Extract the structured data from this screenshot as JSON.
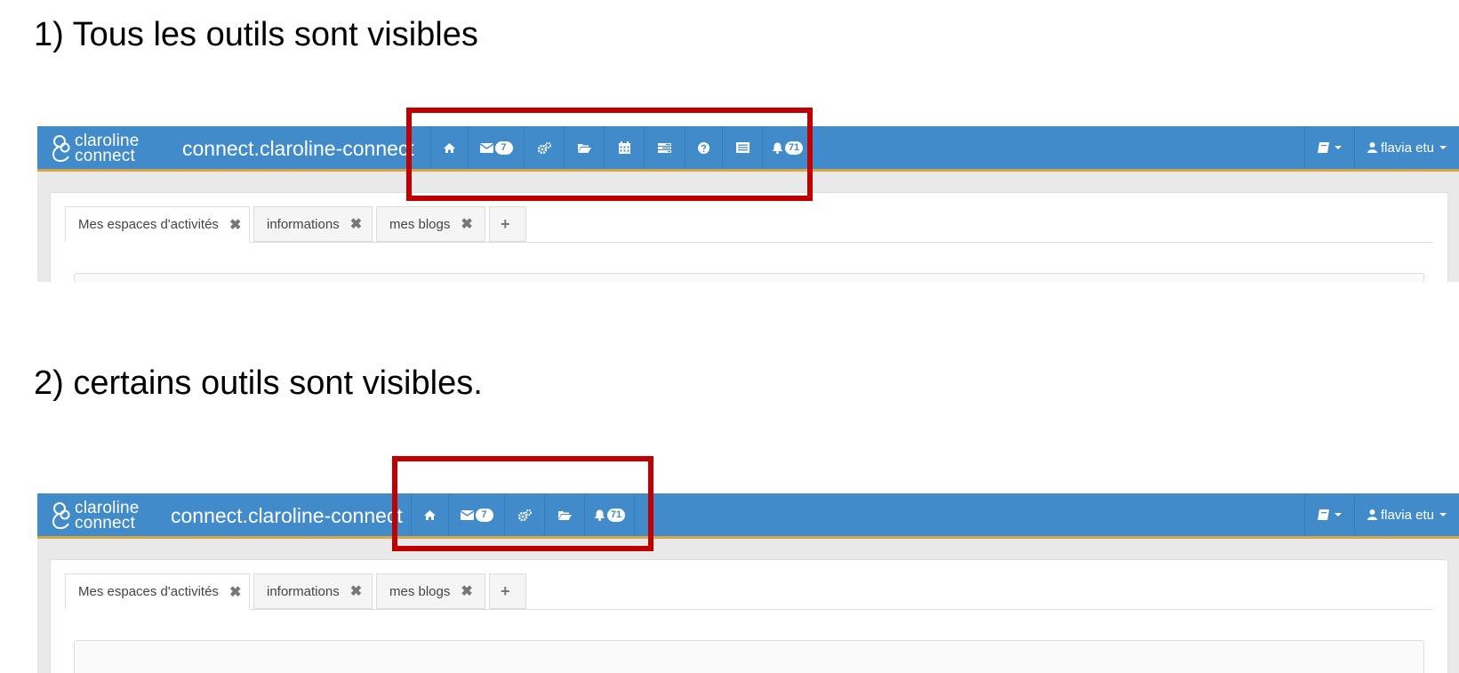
{
  "headings": {
    "first": "1) Tous les outils sont visibles",
    "second": "2) certains outils sont visibles."
  },
  "logo": {
    "line1": "claroline",
    "line2": "connect"
  },
  "navbar": {
    "brand": "connect.claroline-connect",
    "messages_badge": "7",
    "notifications_badge": "71",
    "user_label": "flavia etu",
    "color": "#428bca",
    "accent": "#d8a640"
  },
  "screenshot1": {
    "tools": [
      "home-icon",
      "envelope-icon",
      "cogs-icon",
      "folder-open-icon",
      "calendar-icon",
      "tasks-icon",
      "question-icon",
      "list-icon",
      "bell-icon"
    ]
  },
  "screenshot2": {
    "tools": [
      "home-icon",
      "envelope-icon",
      "cogs-icon",
      "folder-open-icon",
      "bell-icon"
    ]
  },
  "tabs": [
    {
      "label": "Mes espaces d'activités"
    },
    {
      "label": "informations"
    },
    {
      "label": "mes blogs"
    }
  ],
  "close_glyph": "✖",
  "add_glyph": "+",
  "highlight_color": "#c00000"
}
